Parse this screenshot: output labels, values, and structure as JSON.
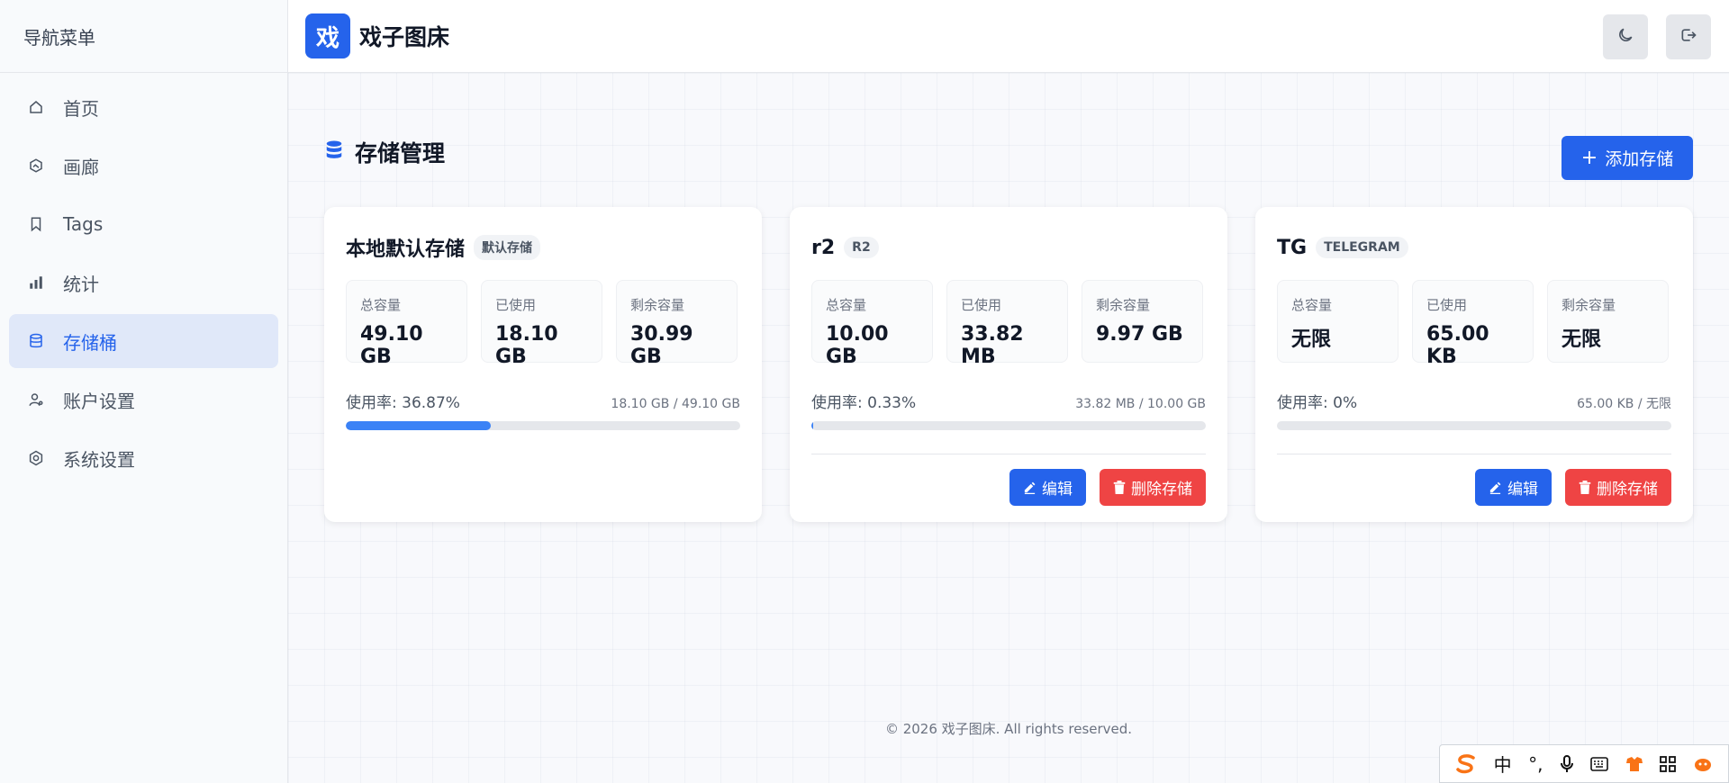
{
  "sidebar": {
    "title": "导航菜单",
    "items": [
      {
        "label": "首页",
        "icon": "home-icon"
      },
      {
        "label": "画廊",
        "icon": "gallery-icon"
      },
      {
        "label": "Tags",
        "icon": "bookmark-icon"
      },
      {
        "label": "统计",
        "icon": "chart-icon"
      },
      {
        "label": "存储桶",
        "icon": "database-icon",
        "active": true
      },
      {
        "label": "账户设置",
        "icon": "user-cog-icon"
      },
      {
        "label": "系统设置",
        "icon": "gear-icon"
      }
    ]
  },
  "header": {
    "logo_text": "戏",
    "title": "戏子图床",
    "actions": [
      "theme-toggle-icon",
      "logout-icon"
    ]
  },
  "page": {
    "title": "存储管理",
    "add_button": "+ 添加存储",
    "add_button_text": "添加存储"
  },
  "cards": [
    {
      "name": "本地默认存储",
      "badge": "默认存储",
      "stats": [
        {
          "label": "总容量",
          "value": "49.10 GB"
        },
        {
          "label": "已使用",
          "value": "18.10 GB"
        },
        {
          "label": "剩余容量",
          "value": "30.99 GB"
        }
      ],
      "usage_label": "使用率: 36.87%",
      "usage_detail": "18.10 GB / 49.10 GB",
      "usage_percent": 36.87,
      "actions": null
    },
    {
      "name": "r2",
      "badge": "R2",
      "stats": [
        {
          "label": "总容量",
          "value": "10.00 GB"
        },
        {
          "label": "已使用",
          "value": "33.82 MB"
        },
        {
          "label": "剩余容量",
          "value": "9.97 GB"
        }
      ],
      "usage_label": "使用率: 0.33%",
      "usage_detail": "33.82 MB / 10.00 GB",
      "usage_percent": 0.33,
      "actions": {
        "edit": "编辑",
        "delete": "删除存储"
      }
    },
    {
      "name": "TG",
      "badge": "TELEGRAM",
      "stats": [
        {
          "label": "总容量",
          "value": "无限"
        },
        {
          "label": "已使用",
          "value": "65.00 KB"
        },
        {
          "label": "剩余容量",
          "value": "无限"
        }
      ],
      "usage_label": "使用率: 0%",
      "usage_detail": "65.00 KB / 无限",
      "usage_percent": 0,
      "actions": {
        "edit": "编辑",
        "delete": "删除存储"
      }
    }
  ],
  "footer": {
    "text": "© 2026 戏子图床. All rights reserved."
  },
  "ime_toolbar": {
    "items": [
      "sogou-logo-icon",
      "中",
      "°,",
      "microphone-icon",
      "keyboard-icon",
      "skin-icon",
      "grid-icon",
      "mascot-icon"
    ]
  },
  "colors": {
    "accent": "#2563eb",
    "danger": "#ef4444",
    "progress": "#3b82f6"
  }
}
